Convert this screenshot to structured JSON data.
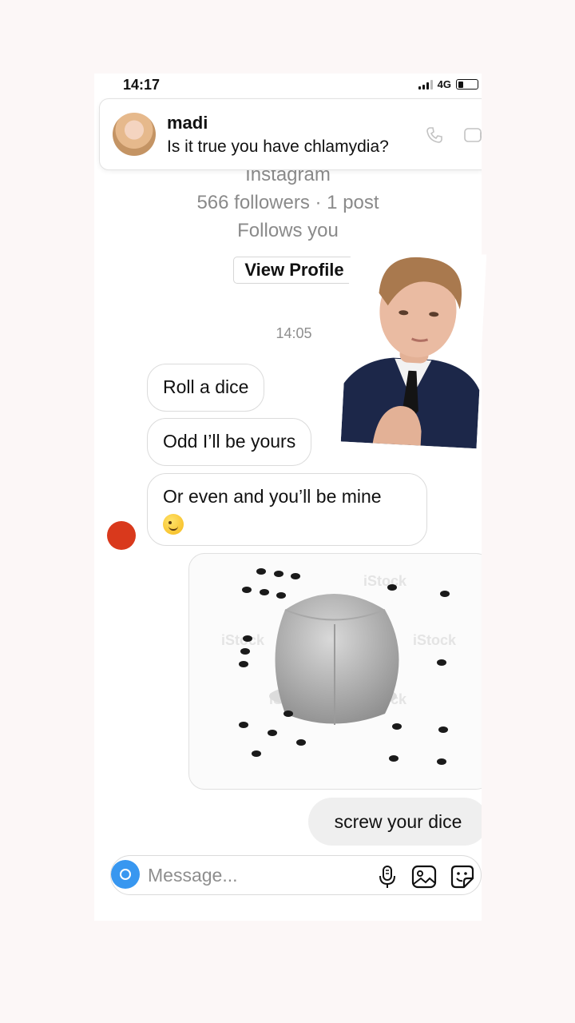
{
  "status_bar": {
    "time": "14:17",
    "network": "4G"
  },
  "notification": {
    "sender": "madi",
    "message": "Is it true you have chlamydia?"
  },
  "profile": {
    "platform": "Instagram",
    "stats": "566 followers · 1 post",
    "relation": "Follows you",
    "view_profile_label": "View Profile"
  },
  "thread": {
    "timestamp": "14:05",
    "incoming": [
      {
        "text": "Roll a dice"
      },
      {
        "text": "Odd I’ll be yours"
      },
      {
        "text": "Or even and you’ll be mine"
      }
    ],
    "outgoing": [
      {
        "text": "screw your dice"
      }
    ],
    "image_watermark": "iStock"
  },
  "composer": {
    "placeholder": "Message..."
  },
  "colors": {
    "accent": "#3897f0",
    "sender_dot": "#d9391c",
    "outgoing_bubble": "#efefef"
  }
}
